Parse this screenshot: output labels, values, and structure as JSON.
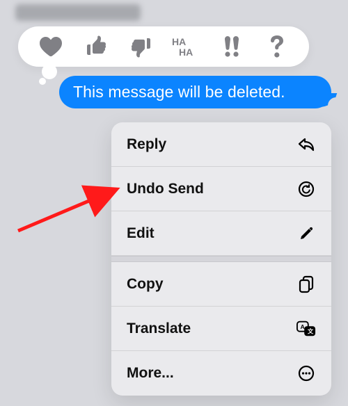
{
  "message": {
    "text": "This message will be deleted."
  },
  "reactions": [
    {
      "name": "heart"
    },
    {
      "name": "thumbs-up"
    },
    {
      "name": "thumbs-down"
    },
    {
      "name": "haha"
    },
    {
      "name": "exclaim"
    },
    {
      "name": "question"
    }
  ],
  "menu": {
    "reply": "Reply",
    "undo": "Undo Send",
    "edit": "Edit",
    "copy": "Copy",
    "translate": "Translate",
    "more": "More..."
  }
}
